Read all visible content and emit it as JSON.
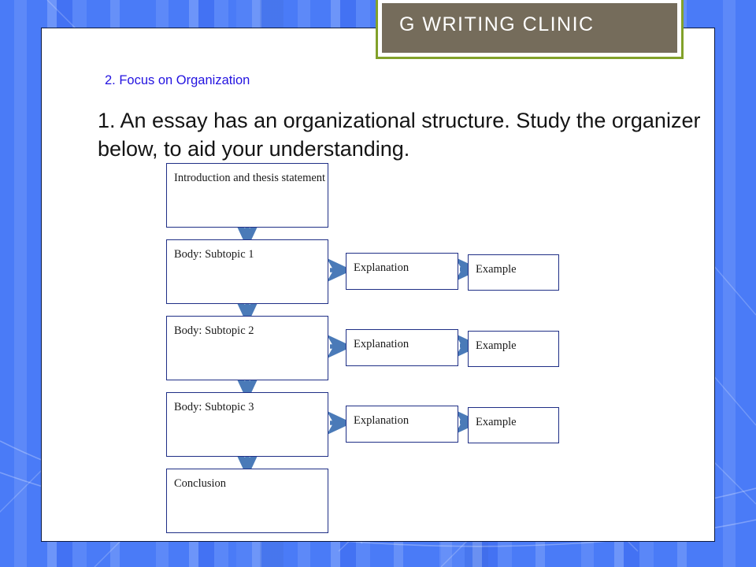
{
  "slide": {
    "banner_title": "G WRITING CLINIC",
    "subheading": "2. Focus on Organization",
    "lead_text": "1. An essay has an organizational structure. Study the organizer below, to aid your understanding."
  },
  "colors": {
    "background_blue": "#4a7bf7",
    "banner_fill": "#756c5b",
    "banner_border_green": "#82a12a",
    "subheading_blue": "#2313e0",
    "node_border": "#1f2f86",
    "arrow_blue": "#4a7ab8",
    "panel_white": "#ffffff"
  },
  "chart_data": {
    "type": "diagram",
    "title": "Essay organizational structure organizer",
    "layout": "vertical-flow-with-branches",
    "spine": [
      {
        "id": "intro",
        "label": "Introduction and thesis statement"
      },
      {
        "id": "body1",
        "label": "Body: Subtopic 1"
      },
      {
        "id": "body2",
        "label": "Body: Subtopic 2"
      },
      {
        "id": "body3",
        "label": "Body: Subtopic 3"
      },
      {
        "id": "conclusion",
        "label": "Conclusion"
      }
    ],
    "branches": [
      {
        "from": "body1",
        "steps": [
          "Explanation",
          "Example"
        ]
      },
      {
        "from": "body2",
        "steps": [
          "Explanation",
          "Example"
        ]
      },
      {
        "from": "body3",
        "steps": [
          "Explanation",
          "Example"
        ]
      }
    ],
    "connectors": [
      {
        "from": "intro",
        "to": "body1",
        "direction": "down"
      },
      {
        "from": "body1",
        "to": "body2",
        "direction": "down"
      },
      {
        "from": "body2",
        "to": "body3",
        "direction": "down"
      },
      {
        "from": "body3",
        "to": "conclusion",
        "direction": "down"
      }
    ]
  },
  "nodes": {
    "intro": "Introduction and thesis statement",
    "body1": "Body: Subtopic 1",
    "body2": "Body: Subtopic 2",
    "body3": "Body: Subtopic 3",
    "conclusion": "Conclusion",
    "explanation1": "Explanation",
    "explanation2": "Explanation",
    "explanation3": "Explanation",
    "example1": "Example",
    "example2": "Example",
    "example3": "Example"
  }
}
